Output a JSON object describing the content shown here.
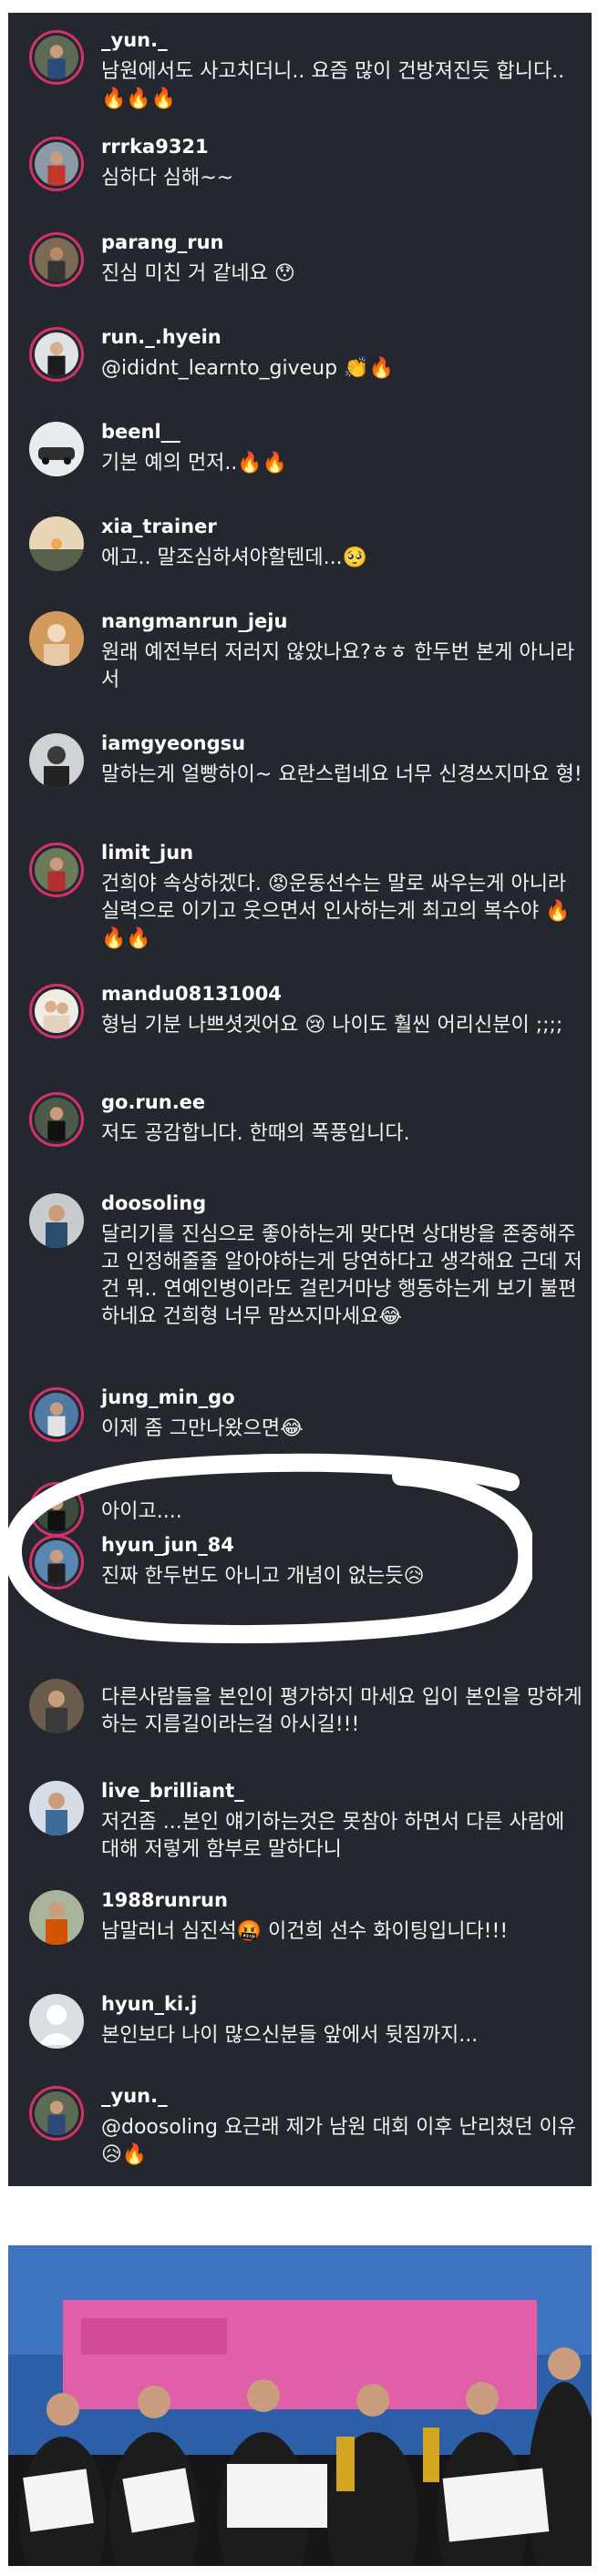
{
  "comments": [
    {
      "username": "_yun._",
      "text": "남원에서도 사고치더니.. 요즘 많이 건방져진듯 합니다.. 🔥🔥🔥",
      "avatar": "runner-photo"
    },
    {
      "username": "rrrka9321",
      "text": "심하다 심해~~",
      "avatar": "runner-photo"
    },
    {
      "username": "parang_run",
      "text": "진심 미친 거 같네요 😯",
      "avatar": "runner-photo"
    },
    {
      "username": "run._.hyein",
      "text": "@ididnt_learnto_giveup 👏🔥",
      "avatar": "runner-photo"
    },
    {
      "username": "beenl__",
      "text": "기본 예의 먼저..🔥🔥",
      "avatar": "car-photo"
    },
    {
      "username": "xia_trainer",
      "text": "에고.. 말조심하셔야할텐데...🥺",
      "avatar": "sunset-photo"
    },
    {
      "username": "nangmanrun_jeju",
      "text": "원래 예전부터 저러지 않았나요?ㅎㅎ 한두번 본게 아니라서",
      "avatar": "portrait-photo"
    },
    {
      "username": "iamgyeongsu",
      "text": "말하는게 얼빵하이~ 요란스럽네요 너무 신경쓰지마요 형!",
      "avatar": "portrait-photo"
    },
    {
      "username": "limit_jun",
      "text": "건희야 속상하겠다. 😡운동선수는 말로 싸우는게 아니라 실력으로 이기고 웃으면서 인사하는게 최고의 복수야 🔥🔥🔥",
      "avatar": "runner-photo"
    },
    {
      "username": "mandu08131004",
      "text": "형님 기분 나쁘셧겟어요 😢 나이도 훨씬 어리신분이 ;;;;",
      "avatar": "family-photo"
    },
    {
      "username": "go.run.ee",
      "text": "저도 공감합니다. 한때의 폭풍입니다.",
      "avatar": "runner-photo"
    },
    {
      "username": "doosoling",
      "text": "달리기를 진심으로 좋아하는게 맞다면 상대방을 존중해주고 인정해줄줄 알아야하는게 당연하다고 생각해요 근데 저건 뭐.. 연예인병이라도 걸린거마냥 행동하는게 보기 불편하네요 건희형 너무 맘쓰지마세요😂",
      "avatar": "runner-photo"
    },
    {
      "username": "jung_min_go",
      "text": "이제 좀 그만나왔으면😂",
      "avatar": "runner-photo"
    },
    {
      "username": "",
      "text": "아이고....",
      "avatar": "runner-photo"
    },
    {
      "username": "hyun_jun_84",
      "text": "진짜 한두번도 아니고 개념이 없는듯😥",
      "avatar": "runner-photo"
    },
    {
      "username": "",
      "text": "다른사람들을 본인이 평가하지 마세요 입이 본인을 망하게 하는 지름길이라는걸 아시길!!!",
      "avatar": "runner-photo"
    },
    {
      "username": "live_brilliant_",
      "text": "저건좀 ...본인 얘기하는것은 못참아 하면서 다른 사람에 대해 저렇게 함부로 말하다니",
      "avatar": "runner-photo"
    },
    {
      "username": "1988runrun",
      "text": "남말러너 심진석🤬 이건희 선수 화이팅입니다!!!",
      "avatar": "runner-photo"
    },
    {
      "username": "hyun_ki.j",
      "text": "본인보다 나이 많으신분들 앞에서 뒷짐까지...",
      "avatar": "default-user-icon"
    },
    {
      "username": "_yun._",
      "text": "@doosoling 요근래 제가 남원 대회 이후 난리쳤던 이유😥🔥",
      "avatar": "runner-photo"
    }
  ],
  "photo": {
    "description_icon": "award-ceremony-photo"
  },
  "colors": {
    "panel_bg": "#24272d",
    "story_ring": "#d4316b",
    "highlight_circle": "#ffffff"
  }
}
